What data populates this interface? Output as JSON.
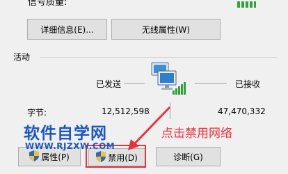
{
  "signal_quality": {
    "label": "信号质量:",
    "bars_level": 5,
    "bars_total": 5
  },
  "buttons_top": {
    "details": "详细信息(E)...",
    "wireless_props": "无线属性(W)"
  },
  "activity": {
    "section_title": "活动",
    "sent_label": "已发送",
    "received_label": "已接收",
    "bytes_label": "字节:",
    "bytes_sent": "12,512,598",
    "bytes_received": "47,470,332"
  },
  "buttons_bottom": {
    "properties": "属性(P)",
    "disable": "禁用(D)",
    "diagnose": "诊断(G)"
  },
  "watermark": {
    "title": "软件自学网",
    "url": "WWW.RJZXW.COM"
  },
  "annotation": {
    "text": "点击禁用网络",
    "color": "#e8323c"
  },
  "colors": {
    "highlight_box": "#e8323c",
    "watermark_blue": "#1a56c8",
    "signal_green": "#2fa33a"
  },
  "icons": {
    "network": "network-computer-icon",
    "shield": "uac-shield-icon"
  }
}
